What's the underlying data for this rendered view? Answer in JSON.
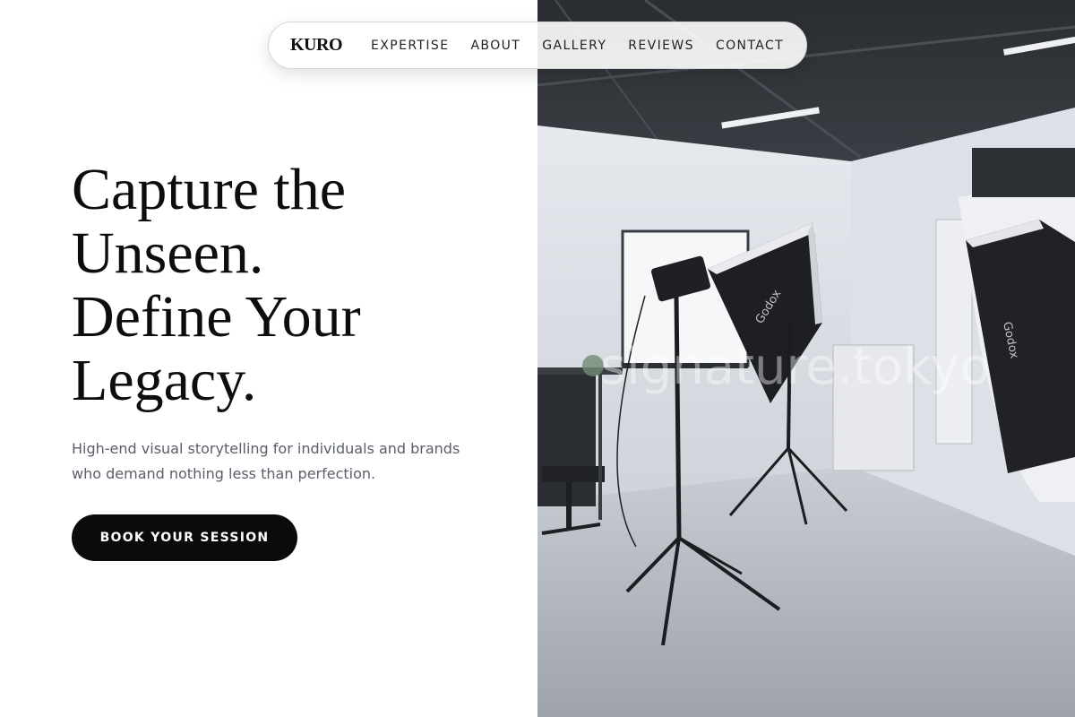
{
  "nav": {
    "logo": "KURO",
    "links": [
      "EXPERTISE",
      "ABOUT",
      "GALLERY",
      "REVIEWS",
      "CONTACT"
    ]
  },
  "hero": {
    "title_lines": [
      "Capture the",
      "Unseen.",
      "Define Your",
      "Legacy."
    ],
    "subtitle": "High-end visual storytelling for individuals and brands who demand nothing less than perfection.",
    "cta": "BOOK YOUR SESSION"
  },
  "photo": {
    "watermark": "signature.tokyo",
    "softbox_brand": "Godox"
  },
  "colors": {
    "primary": "#0b0b0b",
    "text": "#0d0d0d",
    "muted": "#5a5f6b",
    "background": "#ffffff"
  }
}
